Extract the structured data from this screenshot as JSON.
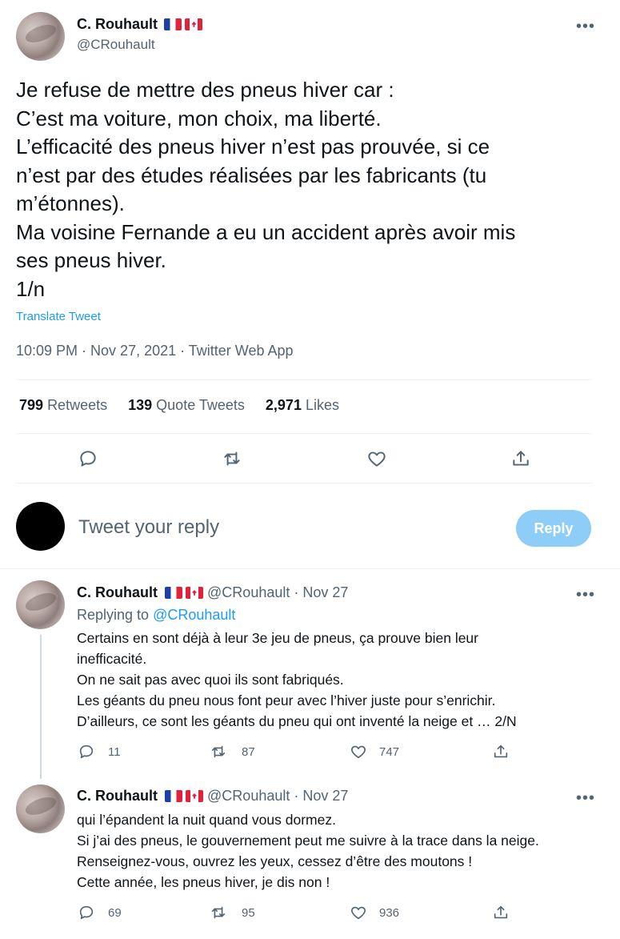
{
  "main_tweet": {
    "author_name": "C. Rouhault",
    "author_handle": "@CRouhault",
    "more_label": "•••",
    "lines": [
      "Je refuse de mettre des pneus hiver car :",
      "C’est ma voiture, mon choix, ma liberté.",
      "L’efficacité des pneus hiver n’est pas prouvée, si ce",
      "n’est par des études réalisées par les fabricants (tu",
      "m’étonnes).",
      "Ma voisine Fernande a eu un accident après avoir mis",
      "ses pneus hiver.",
      "1/n"
    ],
    "translate_label": "Translate Tweet",
    "meta": "10:09 PM · Nov 27, 2021 · Twitter Web App",
    "stats": [
      {
        "count": "799",
        "label": "Retweets"
      },
      {
        "count": "139",
        "label": "Quote Tweets"
      },
      {
        "count": "2,971",
        "label": "Likes"
      }
    ],
    "actions": [
      "reply-icon",
      "retweet-icon",
      "like-icon",
      "share-icon"
    ]
  },
  "reply_box": {
    "placeholder": "Tweet your reply",
    "button_label": "Reply",
    "button_color": "#8ecdf7"
  },
  "replies": [
    {
      "author_name": "C. Rouhault",
      "author_handle": "@CRouhault",
      "date": "· Nov 27",
      "replying_prefix": "Replying to",
      "replying_handle": "@CRouhault",
      "lines": [
        "Certains en sont déjà à leur 3e jeu de pneus, ça prouve bien leur",
        "inefficacité.",
        "On ne sait pas avec quoi ils sont fabriqués.",
        "Les géants du pneu nous font peur avec l’hiver juste pour s’enrichir.",
        "D’ailleurs, ce sont les géants du pneu qui ont inventé la neige et … 2/N"
      ],
      "reply_count": "11",
      "retweet_count": "87",
      "like_count": "747"
    },
    {
      "author_name": "C. Rouhault",
      "author_handle": "@CRouhault",
      "date": "· Nov 27",
      "lines": [
        "qui l’épandent la nuit quand vous dormez.",
        "Si j’ai des pneus, le gouvernement peut me suivre à la trace dans la neige.",
        "Renseignez-vous, ouvrez les yeux, cessez d’être des moutons !",
        "Cette année, les pneus hiver, je dis non !"
      ],
      "reply_count": "69",
      "retweet_count": "95",
      "like_count": "936"
    }
  ],
  "colors": {
    "link": "#1d9bf0",
    "secondary_text": "#536471",
    "divider": "#eff3f4"
  }
}
